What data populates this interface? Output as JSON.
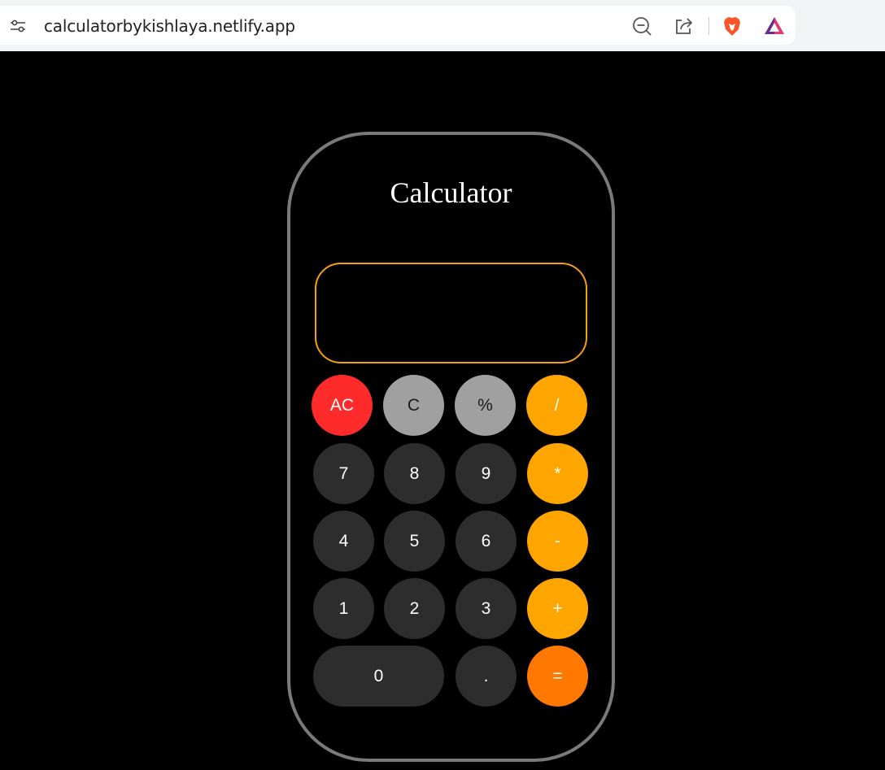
{
  "browser": {
    "url": "calculatorbykishlaya.netlify.app"
  },
  "app": {
    "title": "Calculator",
    "display_value": ""
  },
  "keys": {
    "ac": "AC",
    "clear": "C",
    "percent": "%",
    "divide": "/",
    "seven": "7",
    "eight": "8",
    "nine": "9",
    "multiply": "*",
    "four": "4",
    "five": "5",
    "six": "6",
    "minus": "-",
    "one": "1",
    "two": "2",
    "three": "3",
    "plus": "+",
    "zero": "0",
    "dot": ".",
    "equals": "="
  },
  "colors": {
    "background": "#000000",
    "frame": "#7a7a7a",
    "display_border": "#f5a010",
    "key_dark": "#2d2d2d",
    "key_gray": "#a0a0a0",
    "key_red": "#ff2a2a",
    "key_orange": "#ffa500",
    "key_equals": "#ff7800"
  }
}
